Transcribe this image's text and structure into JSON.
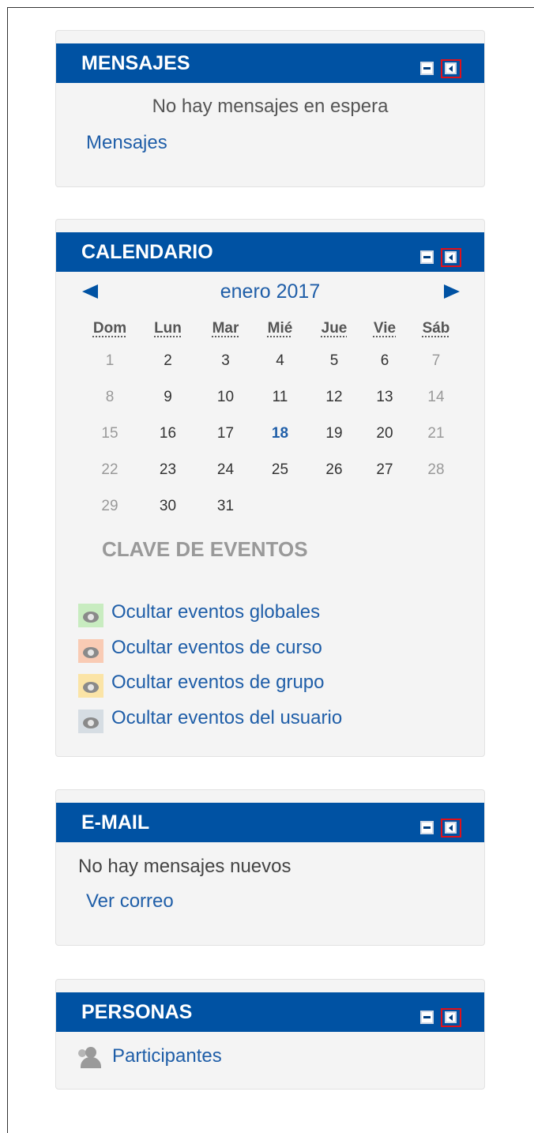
{
  "blocks": {
    "mensajes": {
      "title": "MENSAJES",
      "status": "No hay mensajes en espera",
      "link": "Mensajes"
    },
    "calendario": {
      "title": "CALENDARIO",
      "month": "enero 2017",
      "weekdays": [
        "Dom",
        "Lun",
        "Mar",
        "Mié",
        "Jue",
        "Vie",
        "Sáb"
      ],
      "weeks": [
        [
          "1",
          "2",
          "3",
          "4",
          "5",
          "6",
          "7"
        ],
        [
          "8",
          "9",
          "10",
          "11",
          "12",
          "13",
          "14"
        ],
        [
          "15",
          "16",
          "17",
          "18",
          "19",
          "20",
          "21"
        ],
        [
          "22",
          "23",
          "24",
          "25",
          "26",
          "27",
          "28"
        ],
        [
          "29",
          "30",
          "31",
          "",
          "",
          "",
          ""
        ]
      ],
      "today": "18",
      "events_title": "CLAVE DE EVENTOS",
      "events": [
        {
          "label": "Ocultar eventos globales",
          "color": "#c8ecc0"
        },
        {
          "label": "Ocultar eventos de curso",
          "color": "#f9cbb4"
        },
        {
          "label": "Ocultar eventos de grupo",
          "color": "#fbe4a6"
        },
        {
          "label": "Ocultar eventos del usuario",
          "color": "#d6dde3"
        }
      ]
    },
    "email": {
      "title": "E-MAIL",
      "status": "No hay mensajes nuevos",
      "link": "Ver correo"
    },
    "personas": {
      "title": "PERSONAS",
      "link": "Participantes"
    }
  },
  "colors": {
    "header": "#0052a3",
    "link": "#1f5ea8",
    "dock_highlight": "#e0101a"
  }
}
